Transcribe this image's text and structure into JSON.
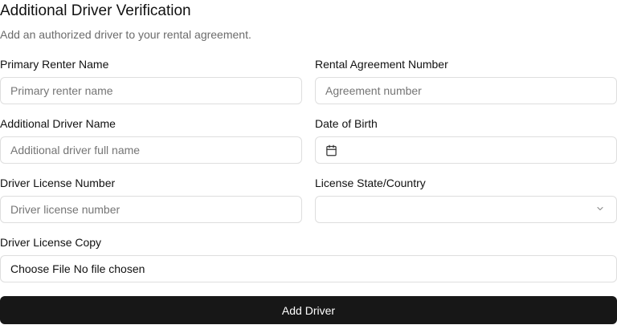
{
  "header": {
    "title": "Additional Driver Verification",
    "subtitle": "Add an authorized driver to your rental agreement."
  },
  "form": {
    "primary_renter": {
      "label": "Primary Renter Name",
      "placeholder": "Primary renter name",
      "value": ""
    },
    "agreement_number": {
      "label": "Rental Agreement Number",
      "placeholder": "Agreement number",
      "value": ""
    },
    "additional_driver": {
      "label": "Additional Driver Name",
      "placeholder": "Additional driver full name",
      "value": ""
    },
    "date_of_birth": {
      "label": "Date of Birth",
      "value": "",
      "icon": "calendar-icon"
    },
    "license_number": {
      "label": "Driver License Number",
      "placeholder": "Driver license number",
      "value": ""
    },
    "license_state": {
      "label": "License State/Country",
      "selected": "",
      "icon": "chevron-down-icon"
    },
    "license_copy": {
      "label": "Driver License Copy",
      "button_label": "Choose File",
      "status": "No file chosen"
    },
    "submit_label": "Add Driver"
  }
}
